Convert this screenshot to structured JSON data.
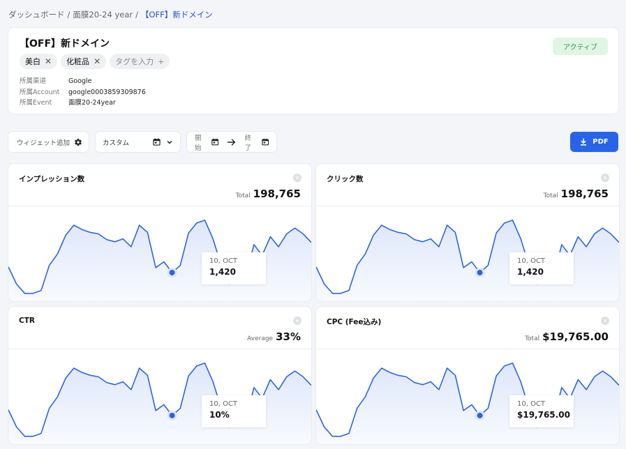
{
  "breadcrumb": {
    "items": [
      "ダッシュボード",
      "面膜20-24 year"
    ],
    "current": "【OFF】新ドメイン"
  },
  "campaign": {
    "title": "【OFF】新ドメイン",
    "status": "アクティブ",
    "tags": [
      "美白",
      "化粧品"
    ],
    "tag_placeholder": "タグを入力",
    "meta": [
      {
        "label": "所属渠道",
        "value": "Google"
      },
      {
        "label": "所属Account",
        "value": "google0003859309876"
      },
      {
        "label": "所属Event",
        "value": "面膜20-24year"
      }
    ]
  },
  "toolbar": {
    "add_widget": "ウィジェット追加",
    "range": "カスタム",
    "start": "開始",
    "end": "終了",
    "pdf": "PDF"
  },
  "colors": {
    "accent": "#2764ea",
    "line": "#2a66e0",
    "status": "#2c9b4b"
  },
  "widgets": [
    {
      "title": "インプレッション数",
      "summary_label": "Total",
      "summary_value": "198,765",
      "tooltip_date": "10, OCT",
      "tooltip_value": "1,420"
    },
    {
      "title": "クリック数",
      "summary_label": "Total",
      "summary_value": "198,765",
      "tooltip_date": "10, OCT",
      "tooltip_value": "1,420"
    },
    {
      "title": "CTR",
      "summary_label": "Average",
      "summary_value": "33%",
      "tooltip_date": "10, OCT",
      "tooltip_value": "10%"
    },
    {
      "title": "CPC (Fee込み)",
      "summary_label": "Total",
      "summary_value": "$19,765.00",
      "tooltip_date": "10, OCT",
      "tooltip_value": "$19,765.00"
    }
  ],
  "chart_data": {
    "type": "area",
    "series": [
      {
        "values": [
          42,
          18,
          5,
          5,
          9,
          44,
          60,
          86,
          100,
          94,
          90,
          88,
          80,
          77,
          81,
          70,
          100,
          90,
          41,
          49,
          34,
          44,
          89,
          103,
          107,
          81,
          44,
          18,
          22,
          28,
          73,
          58,
          84,
          70,
          88,
          96,
          88,
          76
        ]
      }
    ],
    "highlight_index": 20
  }
}
